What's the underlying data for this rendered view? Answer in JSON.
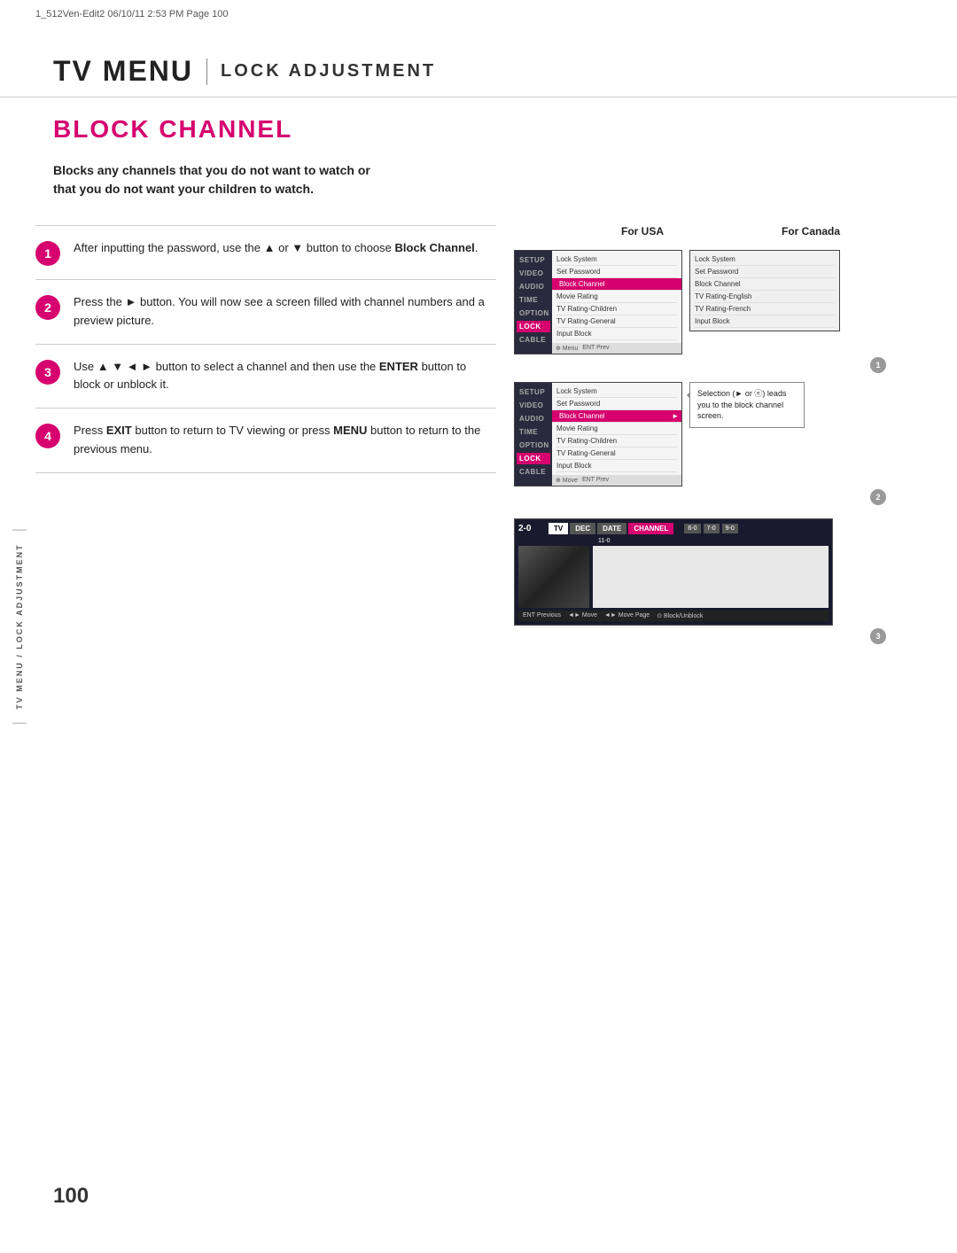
{
  "header_meta": "1_512Ven-Edit2   06/10/11  2:53 PM   Page 100",
  "page_title": {
    "tv_menu": "TV MENU",
    "separator": "|",
    "subtitle": "LOCK ADJUSTMENT"
  },
  "section_title": "BLOCK CHANNEL",
  "intro": "Blocks any channels that you do not want to watch or that you do not want your children to watch.",
  "steps": [
    {
      "number": "1",
      "text": "After inputting the password, use the ▲ or ▼ button to choose Block Channel."
    },
    {
      "number": "2",
      "text": "Press the ► button. You will now see a screen filled with channel numbers and a preview picture."
    },
    {
      "number": "3",
      "text": "Use ▲ ▼ ◄ ► button to select a channel and then use the ENTER button to block or unblock it."
    },
    {
      "number": "4",
      "text": "Press EXIT button to return to TV viewing or press MENU button to return to the previous menu."
    }
  ],
  "col_header_usa": "For USA",
  "col_header_canada": "For Canada",
  "menu_sidebar_items": [
    "SETUP",
    "VIDEO",
    "AUDIO",
    "TIME",
    "OPTION",
    "LOCK",
    "CABLE"
  ],
  "usa_menu_items": [
    "Lock System",
    "Set Password",
    "Block Channel",
    "Movie Rating",
    "TV Rating-Children",
    "TV Rating-General",
    "Input Block"
  ],
  "canada_menu_items": [
    "Lock System",
    "Set Password",
    "Block Channel",
    "TV Rating-English",
    "TV Rating-French",
    "Input Block"
  ],
  "step2_menu_items": [
    "Lock System",
    "Set Password",
    "Block Channel",
    "Movie Rating",
    "TV Rating-Children",
    "TV Rating-General",
    "Input Block"
  ],
  "callout_text": "Selection (► or ⓔ) leads you to the block channel screen.",
  "channel_tabs": [
    "TV",
    "DEC",
    "DATE",
    "CHANNEL"
  ],
  "channel_numbers": [
    "2-0",
    "6-0",
    "7-0",
    "9-0",
    "11-0"
  ],
  "channel_footer_items": [
    "ENT Previous",
    "◄► Move",
    "◄► Move Page",
    "⊙ Block/Unblock"
  ],
  "page_number": "100",
  "vertical_sidebar_text": "TV MENU / LOCK ADJUSTMENT"
}
